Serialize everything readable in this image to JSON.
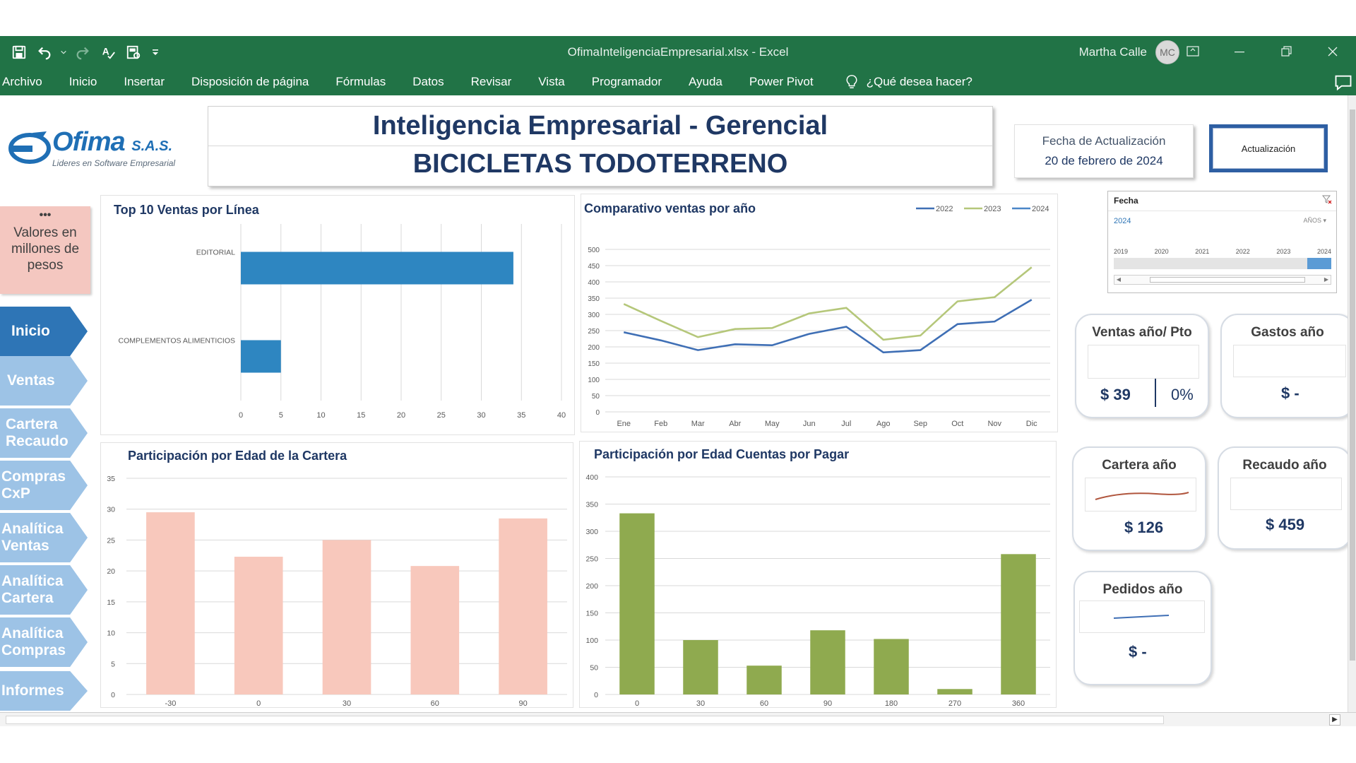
{
  "window": {
    "title": "OfimaInteligenciaEmpresarial.xlsx  -  Excel",
    "user_name": "Martha Calle",
    "user_initials": "MC"
  },
  "ribbon": {
    "tabs": [
      "Archivo",
      "Inicio",
      "Insertar",
      "Disposición de página",
      "Fórmulas",
      "Datos",
      "Revisar",
      "Vista",
      "Programador",
      "Ayuda",
      "Power Pivot"
    ],
    "tell_me": "¿Qué desea hacer?"
  },
  "logo": {
    "brand": "Ofima",
    "suffix": "S.A.S.",
    "tagline": "Lideres en Software Empresarial"
  },
  "header": {
    "title": "Inteligencia Empresarial - Gerencial",
    "subtitle": "BICICLETAS TODOTERRENO"
  },
  "update": {
    "label": "Fecha de Actualización",
    "date": "20 de febrero de 2024",
    "button": "Actualización"
  },
  "units_note": {
    "dots": "•••",
    "text": "Valores en millones de pesos"
  },
  "nav": [
    "Inicio",
    "Ventas",
    "Cartera Recaudo",
    "Compras CxP",
    "Analítica Ventas",
    "Analítica Cartera",
    "Analítica Compras",
    "Informes"
  ],
  "slicer": {
    "title": "Fecha",
    "selected": "2024",
    "level": "AÑOS",
    "years": [
      "2019",
      "2020",
      "2021",
      "2022",
      "2023",
      "2024"
    ]
  },
  "kpis": {
    "ventas": {
      "title": "Ventas año/ Pto",
      "value": "$ 39",
      "pct": "0%"
    },
    "gastos": {
      "title": "Gastos año",
      "value": "$ -"
    },
    "cartera": {
      "title": "Cartera año",
      "value": "$ 126"
    },
    "recaudo": {
      "title": "Recaudo año",
      "value": "$ 459"
    },
    "pedidos": {
      "title": "Pedidos año",
      "value": "$ -"
    }
  },
  "colors": {
    "excel_green": "#217346",
    "nav_active": "#2e75b6",
    "nav": "#9dc3e6",
    "bar_blue": "#2e86c1",
    "bar_salmon": "#f8c8bc",
    "bar_olive": "#8faa4f",
    "line_2022": "#3f6fb5",
    "line_2023": "#b5c77a",
    "line_2024": "#4a86c8"
  },
  "chart_data": [
    {
      "type": "bar",
      "orientation": "horizontal",
      "title": "Top 10 Ventas por Línea",
      "categories": [
        "EDITORIAL",
        "COMPLEMENTOS ALIMENTICIOS"
      ],
      "values": [
        34,
        5
      ],
      "xlim": [
        0,
        40
      ],
      "ticks": [
        0,
        5,
        10,
        15,
        20,
        25,
        30,
        35,
        40
      ],
      "grid": true
    },
    {
      "type": "line",
      "title": "Comparativo ventas por año",
      "categories": [
        "Ene",
        "Feb",
        "Mar",
        "Abr",
        "May",
        "Jun",
        "Jul",
        "Ago",
        "Sep",
        "Oct",
        "Nov",
        "Dic"
      ],
      "series": [
        {
          "name": "2022",
          "values": [
            245,
            220,
            190,
            208,
            205,
            240,
            262,
            183,
            190,
            270,
            278,
            345
          ]
        },
        {
          "name": "2023",
          "values": [
            332,
            280,
            230,
            255,
            258,
            303,
            320,
            222,
            235,
            340,
            353,
            445
          ]
        },
        {
          "name": "2024",
          "values": []
        }
      ],
      "ylim": [
        0,
        500
      ],
      "ticks": [
        0,
        50,
        100,
        150,
        200,
        250,
        300,
        350,
        400,
        450,
        500
      ],
      "legend": "top-right",
      "grid": true
    },
    {
      "type": "bar",
      "title": "Participación por Edad de la Cartera",
      "categories": [
        "-30",
        "0",
        "30",
        "60",
        "90"
      ],
      "values": [
        29.5,
        22.3,
        25,
        20.8,
        28.5
      ],
      "ylim": [
        0,
        35
      ],
      "ticks": [
        0,
        5,
        10,
        15,
        20,
        25,
        30,
        35
      ],
      "grid": true
    },
    {
      "type": "bar",
      "title": "Participación por Edad  Cuentas por Pagar",
      "categories": [
        "0",
        "30",
        "60",
        "90",
        "180",
        "270",
        "360"
      ],
      "values": [
        333,
        100,
        53,
        118,
        102,
        10,
        258
      ],
      "ylim": [
        0,
        400
      ],
      "ticks": [
        0,
        50,
        100,
        150,
        200,
        250,
        300,
        350,
        400
      ],
      "grid": true
    }
  ]
}
